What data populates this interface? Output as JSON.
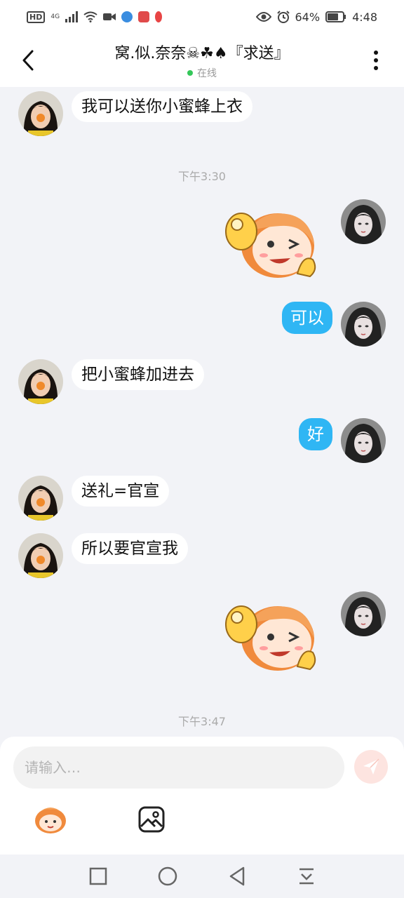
{
  "status_bar": {
    "hd": "HD",
    "network": "4G",
    "battery": "64%",
    "time": "4:48"
  },
  "header": {
    "title": "窝.似.奈奈☠☘♠『求送』",
    "status": "在线"
  },
  "messages": [
    {
      "side": "left",
      "text": "我可以送你小蜜蜂上衣"
    },
    {
      "timestamp": "下午3:30"
    },
    {
      "side": "right",
      "sticker": "ok-thumbs-sticker"
    },
    {
      "side": "right",
      "text": "可以"
    },
    {
      "side": "left",
      "text": "把小蜜蜂加进去"
    },
    {
      "side": "right",
      "text": "好"
    },
    {
      "side": "left",
      "text": "送礼=官宣"
    },
    {
      "side": "left",
      "text": "所以要官宣我"
    },
    {
      "side": "right",
      "sticker": "ok-thumbs-sticker"
    },
    {
      "timestamp": "下午3:47"
    }
  ],
  "composer": {
    "placeholder": "请输入…"
  },
  "colors": {
    "my_bubble": "#2fb6f4",
    "their_bubble": "#ffffff",
    "chat_bg": "#f2f3f7",
    "online": "#34c759",
    "send_button": "#fde4e0"
  }
}
